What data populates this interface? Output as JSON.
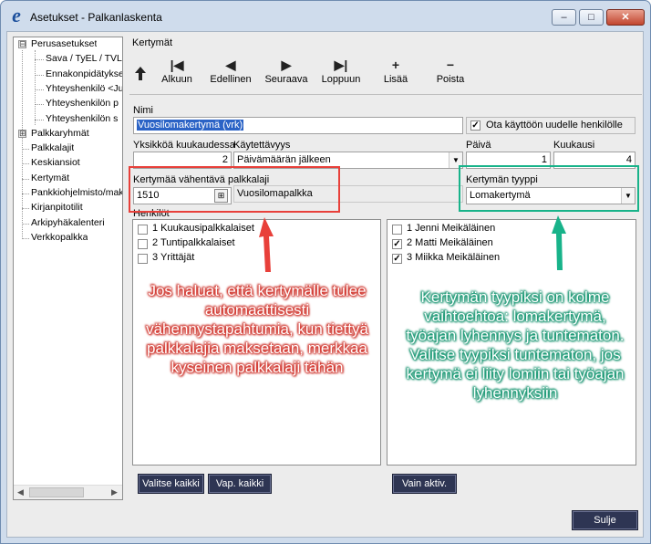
{
  "window": {
    "title": "Asetukset - Palkanlaskenta",
    "controls": {
      "minimize": "–",
      "maximize": "□",
      "close": "✕"
    }
  },
  "tree": {
    "items": [
      {
        "label": "Perusasetukset",
        "expander": "⊟"
      },
      {
        "label": "Sava / TyEL / TVL"
      },
      {
        "label": "Ennakonpidätykse"
      },
      {
        "label": "Yhteyshenkilö <Ju"
      },
      {
        "label": "Yhteyshenkilön p"
      },
      {
        "label": "Yhteyshenkilön s"
      },
      {
        "label": "Palkkaryhmät",
        "expander": "⊞"
      },
      {
        "label": "Palkkalajit"
      },
      {
        "label": "Keskiansiot"
      },
      {
        "label": "Kertymät"
      },
      {
        "label": "Pankkiohjelmisto/mak"
      },
      {
        "label": "Kirjanpitotilit"
      },
      {
        "label": "Arkipyhäkalenteri"
      },
      {
        "label": "Verkkopalkka"
      }
    ]
  },
  "section": {
    "title": "Kertymät"
  },
  "toolbar": {
    "up_icon": "up-arrow-icon",
    "buttons": [
      {
        "label": "Alkuun",
        "glyph": "|◀",
        "icon": "first-record-icon"
      },
      {
        "label": "Edellinen",
        "glyph": "◀",
        "icon": "previous-record-icon"
      },
      {
        "label": "Seuraava",
        "glyph": "▶",
        "icon": "next-record-icon"
      },
      {
        "label": "Loppuun",
        "glyph": "▶|",
        "icon": "last-record-icon"
      },
      {
        "label": "Lisää",
        "glyph": "+",
        "icon": "add-icon"
      },
      {
        "label": "Poista",
        "glyph": "−",
        "icon": "remove-icon"
      }
    ]
  },
  "form": {
    "nimi_label": "Nimi",
    "nimi_value": "Vuosilomakertymä (vrk)",
    "use_new_label": "Ota käyttöön uudelle henkilölle",
    "use_new_checked": "✓",
    "yksikkoa_label": "Yksikköä kuukaudessa",
    "yksikkoa_value": "2",
    "kaytettavyys_label": "Käytettävyys",
    "kaytettavyys_value": "Päivämäärän jälkeen",
    "paiva_label": "Päivä",
    "paiva_value": "1",
    "kuukausi_label": "Kuukausi",
    "kuukausi_value": "4",
    "vahentava_label": "Kertymää vähentävä palkkalaji",
    "vahentava_code": "1510",
    "vahentava_name": "Vuosilomapalkka",
    "tyyppi_label": "Kertymän tyyppi",
    "tyyppi_value": "Lomakertymä",
    "henkilot_label": "Henkilöt",
    "dropdown_glyph": "▼",
    "calc_glyph": "⊞"
  },
  "groups": [
    {
      "label": "1 Kuukausipalkkalaiset",
      "checked": ""
    },
    {
      "label": "2 Tuntipalkkalaiset",
      "checked": ""
    },
    {
      "label": "3 Yrittäjät",
      "checked": ""
    }
  ],
  "persons": [
    {
      "label": "1 Jenni Meikäläinen",
      "checked": ""
    },
    {
      "label": "2 Matti Meikäläinen",
      "checked": "✓"
    },
    {
      "label": "3 Miikka Meikäläinen",
      "checked": "✓"
    }
  ],
  "buttons": {
    "select_all": "Valitse kaikki",
    "clear_all": "Vap. kaikki",
    "only_active": "Vain aktiv.",
    "close": "Sulje"
  },
  "annotations": {
    "red_text": "Jos haluat, että kertymälle tulee automaattisesti vähennystapahtumia, kun tiettyä palkkalajia maksetaan, merkkaa kyseinen palkkalaji tähän",
    "teal_text": "Kertymän tyypiksi on kolme vaihtoehtoa: lomakertymä, työajan lyhennys ja tuntematon. Valitse tyypiksi tuntematon, jos kertymä ei liity lomiin tai työajan lyhennyksiin",
    "red_color": "#e8403a",
    "teal_color": "#18b38a"
  }
}
